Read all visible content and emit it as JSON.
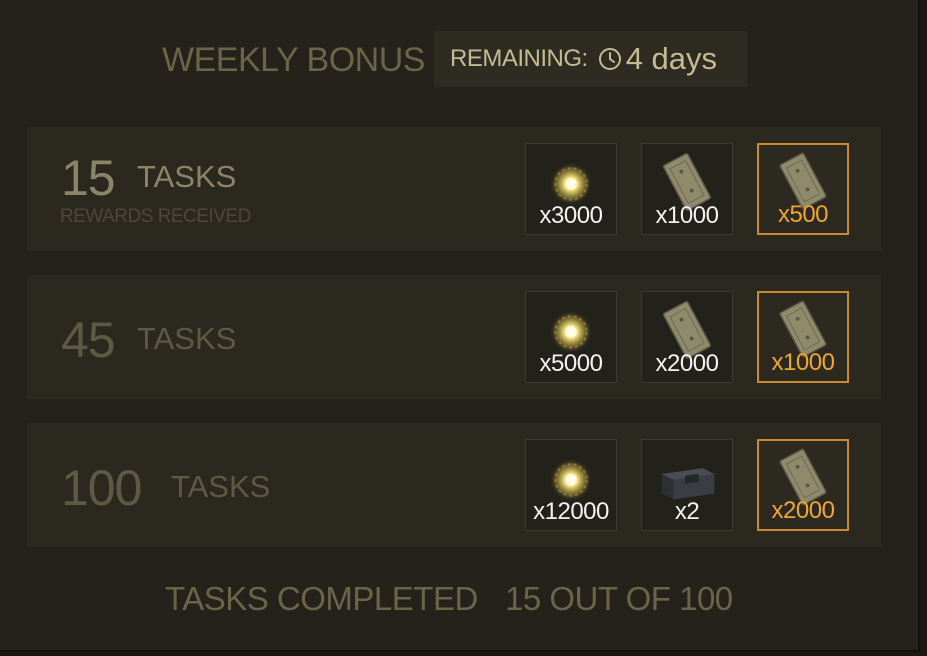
{
  "header": {
    "title": "WEEKLY BONUS",
    "remaining_label": "REMAINING:",
    "remaining_icon": "clock-icon",
    "remaining_value": "4 days"
  },
  "tiers": [
    {
      "count": "15",
      "unit": "TASKS",
      "status": "REWARDS RECEIVED",
      "rewards": [
        {
          "icon": "energy-orb-icon",
          "qty": "x3000"
        },
        {
          "icon": "parts-plate-icon",
          "qty": "x1000"
        },
        {
          "icon": "parts-plate-icon",
          "qty": "x500"
        }
      ]
    },
    {
      "count": "45",
      "unit": "TASKS",
      "rewards": [
        {
          "icon": "energy-orb-icon",
          "qty": "x5000"
        },
        {
          "icon": "parts-plate-icon",
          "qty": "x2000"
        },
        {
          "icon": "parts-plate-icon",
          "qty": "x1000"
        }
      ]
    },
    {
      "count": "100",
      "unit": "TASKS",
      "rewards": [
        {
          "icon": "energy-orb-icon",
          "qty": "x12000"
        },
        {
          "icon": "supply-crate-icon",
          "qty": "x2"
        },
        {
          "icon": "parts-plate-icon",
          "qty": "x2000"
        }
      ]
    }
  ],
  "footer": {
    "label": "TASKS COMPLETED",
    "value": "15 OUT OF 100"
  },
  "colors": {
    "highlight_border": "#c98a2a",
    "highlight_text": "#f0a431",
    "muted_text": "#6b6447"
  }
}
